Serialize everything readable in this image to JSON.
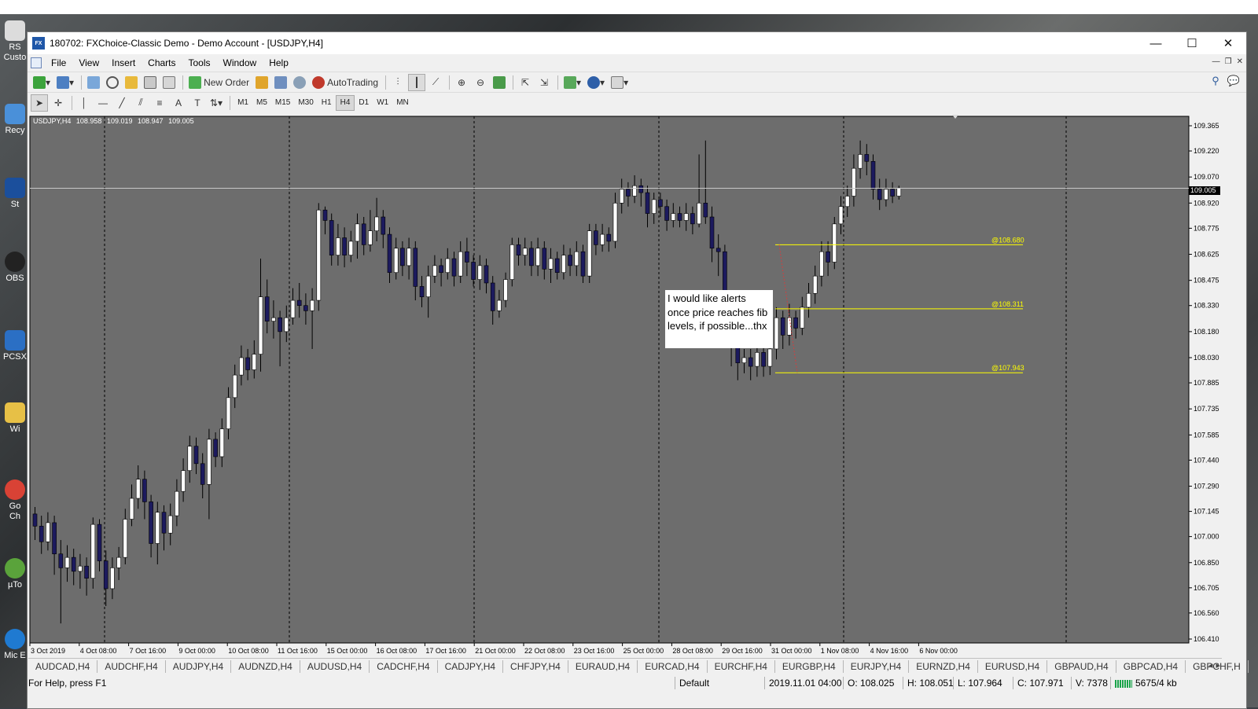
{
  "desktop": {
    "icons": [
      "RS\nCusto",
      "Recy",
      "St",
      "OBS",
      "PCSX",
      "Wi",
      "Go\nCh",
      "µTo",
      "Mic\nE"
    ]
  },
  "window": {
    "title": "180702: FXChoice-Classic Demo - Demo Account - [USDJPY,H4]",
    "app_icon_text": "FX",
    "controls": {
      "minimize": "—",
      "maximize": "☐",
      "close": "✕"
    }
  },
  "menu": [
    "File",
    "View",
    "Insert",
    "Charts",
    "Tools",
    "Window",
    "Help"
  ],
  "toolbar": {
    "new_order": "New Order",
    "autotrading": "AutoTrading"
  },
  "timeframes": [
    "M1",
    "M5",
    "M15",
    "M30",
    "H1",
    "H4",
    "D1",
    "W1",
    "MN"
  ],
  "active_timeframe": "H4",
  "chart": {
    "header": {
      "symbol": "USDJPY,H4",
      "open": "108.958",
      "high": "109.019",
      "low": "108.947",
      "close": "109.005"
    },
    "current_price": "109.005",
    "price_labels": [
      "109.365",
      "109.220",
      "109.070",
      "108.920",
      "108.775",
      "108.625",
      "108.475",
      "108.330",
      "108.180",
      "108.030",
      "107.885",
      "107.735",
      "107.585",
      "107.440",
      "107.290",
      "107.145",
      "107.000",
      "106.850",
      "106.705",
      "106.560",
      "106.410"
    ],
    "time_labels": [
      "3 Oct 2019",
      "4 Oct 08:00",
      "7 Oct 16:00",
      "9 Oct 00:00",
      "10 Oct 08:00",
      "11 Oct 16:00",
      "15 Oct 00:00",
      "16 Oct 08:00",
      "17 Oct 16:00",
      "21 Oct 00:00",
      "22 Oct 08:00",
      "23 Oct 16:00",
      "25 Oct 00:00",
      "28 Oct 08:00",
      "29 Oct 16:00",
      "31 Oct 00:00",
      "1 Nov 08:00",
      "4 Nov 16:00",
      "6 Nov 00:00"
    ],
    "fib_levels": [
      {
        "label": "@108.680",
        "value": 108.68
      },
      {
        "label": "@108.311",
        "value": 108.311
      },
      {
        "label": "@107.943",
        "value": 107.943
      }
    ],
    "note": "I would like alerts once price reaches fib levels, if possible...thx",
    "colors": {
      "background": "#6d6d6d",
      "bull_candle": "#ffffff",
      "bear_candle": "#1c1a5e",
      "fib_line": "#ffff00",
      "grid": "#000000"
    }
  },
  "symbol_tabs": [
    "AUDCAD,H4",
    "AUDCHF,H4",
    "AUDJPY,H4",
    "AUDNZD,H4",
    "AUDUSD,H4",
    "CADCHF,H4",
    "CADJPY,H4",
    "CHFJPY,H4",
    "EURAUD,H4",
    "EURCAD,H4",
    "EURCHF,H4",
    "EURGBP,H4",
    "EURJPY,H4",
    "EURNZD,H4",
    "EURUSD,H4",
    "GBPAUD,H4",
    "GBPCAD,H4",
    "GBPCHF,H"
  ],
  "status": {
    "help": "For Help, press F1",
    "profile": "Default",
    "datetime": "2019.11.01 04:00",
    "open": "O: 108.025",
    "high": "H: 108.051",
    "low": "L: 107.964",
    "close": "C: 107.971",
    "volume": "V: 7378",
    "traffic": "5675/4 kb"
  }
}
